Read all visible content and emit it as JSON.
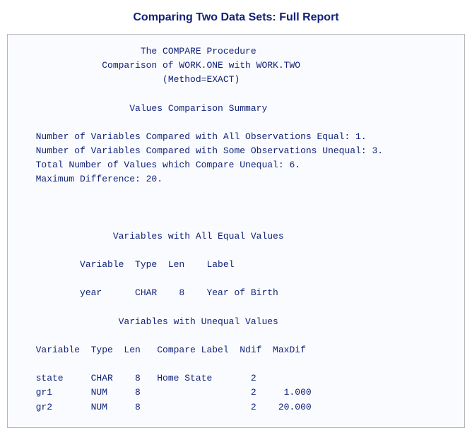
{
  "title": "Comparing Two Data Sets: Full Report",
  "header": {
    "line1": "The COMPARE Procedure",
    "line2": "Comparison of WORK.ONE with WORK.TWO",
    "line3": "(Method=EXACT)"
  },
  "summary": {
    "heading": "Values Comparison Summary",
    "lines": [
      "Number of Variables Compared with All Observations Equal: 1.",
      "Number of Variables Compared with Some Observations Unequal: 3.",
      "Total Number of Values which Compare Unequal: 6.",
      "Maximum Difference: 20."
    ]
  },
  "equalTable": {
    "heading": "Variables with All Equal Values",
    "columns": [
      "Variable",
      "Type",
      "Len",
      "Label"
    ],
    "rows": [
      {
        "variable": "year",
        "type": "CHAR",
        "len": "8",
        "label": "Year of Birth"
      }
    ]
  },
  "unequalTable": {
    "heading": "Variables with Unequal Values",
    "columns": [
      "Variable",
      "Type",
      "Len",
      "Compare Label",
      "Ndif",
      "MaxDif"
    ],
    "rows": [
      {
        "variable": "state",
        "type": "CHAR",
        "len": "8",
        "compareLabel": "Home State",
        "ndif": "2",
        "maxdif": ""
      },
      {
        "variable": "gr1",
        "type": "NUM",
        "len": "8",
        "compareLabel": "",
        "ndif": "2",
        "maxdif": "1.000"
      },
      {
        "variable": "gr2",
        "type": "NUM",
        "len": "8",
        "compareLabel": "",
        "ndif": "2",
        "maxdif": "20.000"
      }
    ]
  }
}
